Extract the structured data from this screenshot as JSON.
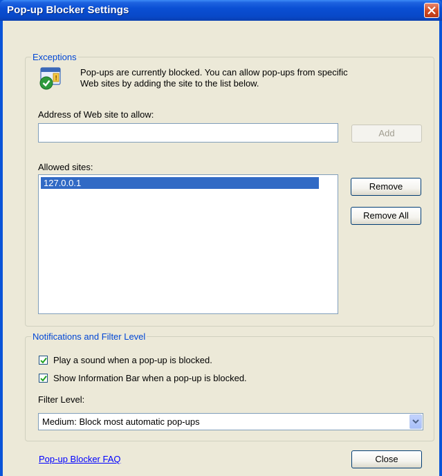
{
  "window": {
    "title": "Pop-up Blocker Settings"
  },
  "exceptions": {
    "legend": "Exceptions",
    "description_line1": "Pop-ups are currently blocked.  You can allow pop-ups from specific",
    "description_line2": "Web sites by adding the site to the list below.",
    "address_label": "Address of Web site to allow:",
    "address_value": "",
    "add_label": "Add",
    "allowed_label": "Allowed sites:",
    "allowed_sites": [
      "127.0.0.1"
    ],
    "remove_label": "Remove",
    "remove_all_label": "Remove All"
  },
  "notifications": {
    "legend": "Notifications and Filter Level",
    "play_sound_label": "Play a sound when a pop-up is blocked.",
    "play_sound_checked": true,
    "info_bar_label": "Show Information Bar when a pop-up is blocked.",
    "info_bar_checked": true,
    "filter_level_label": "Filter Level:",
    "filter_level_value": "Medium: Block most automatic pop-ups"
  },
  "footer": {
    "faq_link": "Pop-up Blocker FAQ",
    "close_label": "Close"
  },
  "colors": {
    "title_bar": "#0a4fd4",
    "dialog_bg": "#ece9d8",
    "legend_text": "#0046d5",
    "selection": "#316ac5"
  }
}
